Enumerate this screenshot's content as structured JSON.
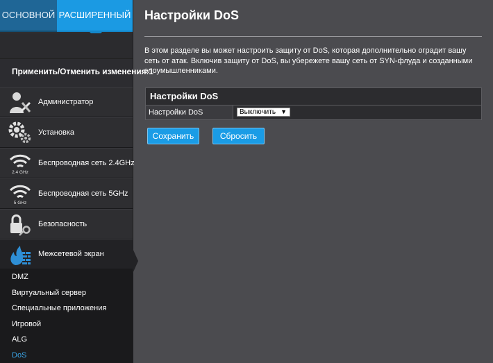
{
  "tabs": {
    "basic": "ОСНОВНОЙ",
    "advanced": "РАСШИРЕННЫЙ"
  },
  "sidebar": {
    "apply_text": "Применить/Отменить изменения:1",
    "items": [
      {
        "label": "Администратор",
        "icon": "admin-tools-icon"
      },
      {
        "label": "Установка",
        "icon": "gears-icon"
      },
      {
        "label": "Беспроводная сеть 2.4GHz",
        "icon": "wifi-icon",
        "badge": "2.4 GHz"
      },
      {
        "label": "Беспроводная сеть 5GHz",
        "icon": "wifi-icon",
        "badge": "5 GHz"
      },
      {
        "label": "Безопасность",
        "icon": "lock-key-icon"
      },
      {
        "label": "Межсетевой экран",
        "icon": "firewall-icon"
      }
    ],
    "submenu": [
      "DMZ",
      "Виртуальный сервер",
      "Специальные приложения",
      "Игровой",
      "ALG",
      "DoS"
    ],
    "current": "DoS"
  },
  "main": {
    "title": "Настройки DoS",
    "description": "В этом разделе вы может настроить защиту от DoS, которая дополнительно оградит вашу сеть от атак. Включив защиту от DoS, вы убережете вашу сеть от SYN-флуда и созданными злоумышленниками.",
    "panel_title": "Настройки DoS",
    "row_label": "Настройки DoS",
    "select_value": "Выключить",
    "save_label": "Сохранить",
    "reset_label": "Сбросить"
  },
  "colors": {
    "accent": "#1b9ae3",
    "current_link": "#3aa6e8"
  }
}
